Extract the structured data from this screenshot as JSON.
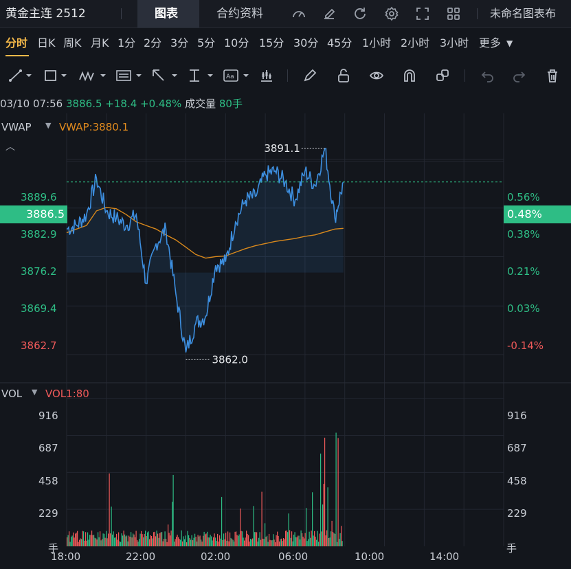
{
  "header": {
    "symbol": "黄金主连 2512",
    "tab_chart": "图表",
    "tab_contract": "合约资料",
    "right_label": "未命名图表布"
  },
  "periods": [
    "分时",
    "日K",
    "周K",
    "月K",
    "1分",
    "2分",
    "3分",
    "5分",
    "10分",
    "15分",
    "30分",
    "45分",
    "1小时",
    "2小时",
    "3小时",
    "更多"
  ],
  "active_period": "分时",
  "info": {
    "datetime": "03/10 07:56",
    "price": "3886.5",
    "change": "+18.4",
    "change_pct": "+0.48%",
    "volume_label": "成交量",
    "volume": "80手"
  },
  "indicator": {
    "name": "VWAP",
    "value_label": "VWAP:3880.1"
  },
  "volume_panel": {
    "name": "VOL",
    "value_label": "VOL1:80",
    "unit": "手"
  },
  "price_axis_left": [
    "3889.6",
    "3882.9",
    "3876.2",
    "3869.4",
    "3862.7"
  ],
  "price_axis_right": [
    "0.56%",
    "0.38%",
    "0.21%",
    "0.03%",
    "-0.14%"
  ],
  "current_price_tag": "3886.5",
  "current_pct_tag": "0.48%",
  "high_annotation": "3891.1",
  "low_annotation": "3862.0",
  "vol_axis": [
    "916",
    "687",
    "458",
    "229"
  ],
  "time_axis": [
    "18:00",
    "22:00",
    "02:00",
    "06:00",
    "10:00",
    "14:00"
  ],
  "colors": {
    "price_line": "#3d8fe0",
    "vwap_line": "#d9891c",
    "up": "#2ebd85",
    "down": "#f05a5a",
    "accent": "#f5b94a"
  },
  "chart_data": {
    "type": "line",
    "x_label_ticks": [
      "18:00",
      "22:00",
      "02:00",
      "06:00",
      "10:00",
      "14:00"
    ],
    "price_series": {
      "name": "VWAP",
      "x": [
        "18:00",
        "18:30",
        "19:00",
        "19:30",
        "20:00",
        "20:30",
        "21:00",
        "21:30",
        "22:00",
        "22:30",
        "23:00",
        "23:30",
        "00:00",
        "00:30",
        "01:00",
        "01:30",
        "02:00",
        "02:30",
        "03:00",
        "03:30",
        "04:00",
        "04:30",
        "05:00",
        "05:30",
        "06:00",
        "06:30",
        "07:00",
        "07:30",
        "07:56"
      ],
      "price": [
        3880.0,
        3880.5,
        3882.0,
        3887.0,
        3882.5,
        3881.5,
        3880.5,
        3882.0,
        3872.5,
        3878.0,
        3880.0,
        3871.0,
        3863.0,
        3867.0,
        3868.0,
        3875.0,
        3875.5,
        3881.0,
        3884.0,
        3884.5,
        3887.5,
        3888.0,
        3886.5,
        3884.0,
        3888.0,
        3886.0,
        3891.1,
        3881.5,
        3886.5
      ],
      "vwap": [
        3879.5,
        3880.0,
        3880.5,
        3882.5,
        3883.0,
        3882.8,
        3882.0,
        3881.0,
        3880.5,
        3880.0,
        3879.2,
        3878.5,
        3877.5,
        3876.5,
        3876.0,
        3876.2,
        3876.3,
        3876.8,
        3877.3,
        3877.7,
        3878.0,
        3878.3,
        3878.5,
        3878.7,
        3879.0,
        3879.2,
        3879.6,
        3880.0,
        3880.1
      ]
    },
    "y_range": [
      3859.0,
      3895.0
    ],
    "high": 3891.1,
    "low": 3862.0,
    "volume_ylim": [
      0,
      1000
    ],
    "volume_ticks": [
      229,
      458,
      687,
      916
    ]
  }
}
